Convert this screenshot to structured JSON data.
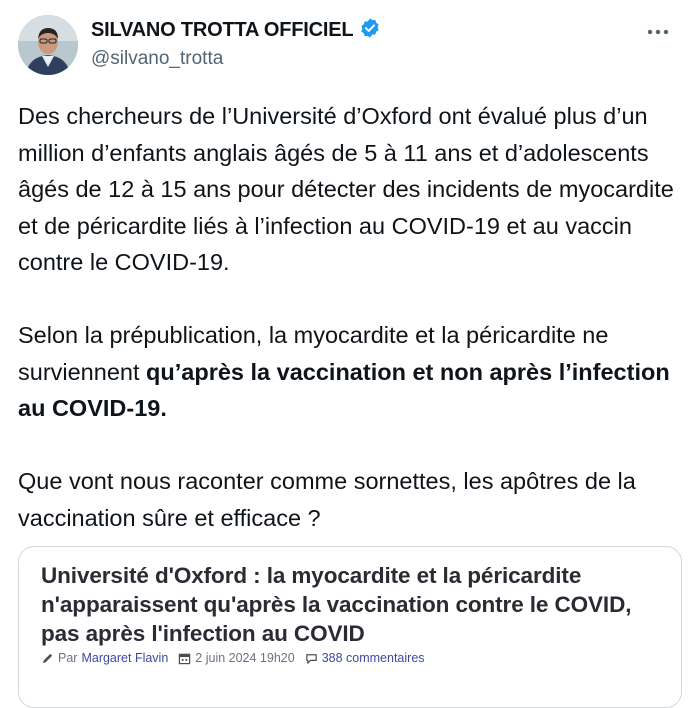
{
  "author": {
    "display_name": "SILVANO TROTTA OFFICIEL",
    "handle": "@silvano_trotta",
    "verified": true
  },
  "tweet": {
    "p1": "Des chercheurs de l’Université d’Oxford ont évalué plus d’un million d’enfants anglais âgés de 5 à 11 ans et d’adolescents âgés de 12 à 15 ans pour détecter des incidents de myocardite et de péricardite liés à l’infection au COVID-19 et au vaccin contre le COVID-19.",
    "p2_start": "Selon la prépublication, la myocardite et la péricardite ne surviennent ",
    "p2_bold": "qu’après la vaccination et non après l’infection au COVID-19.",
    "p3": "Que vont nous raconter comme sornettes, les apôtres de la vaccination sûre et efficace ?"
  },
  "card": {
    "title": "Université d'Oxford : la myocardite et la péricardite n'apparaissent qu'après la vaccination contre le COVID, pas après l'infection au COVID",
    "by_label": "Par",
    "author": "Margaret Flavin",
    "date": "2 juin 2024 19h20",
    "comments": "388 commentaires"
  },
  "colors": {
    "verified_blue": "#1d9bf0",
    "text": "#0f1419",
    "muted": "#536471"
  },
  "icons": [
    "more-icon",
    "verified-badge-icon",
    "pencil-icon",
    "calendar-icon",
    "comment-icon"
  ]
}
